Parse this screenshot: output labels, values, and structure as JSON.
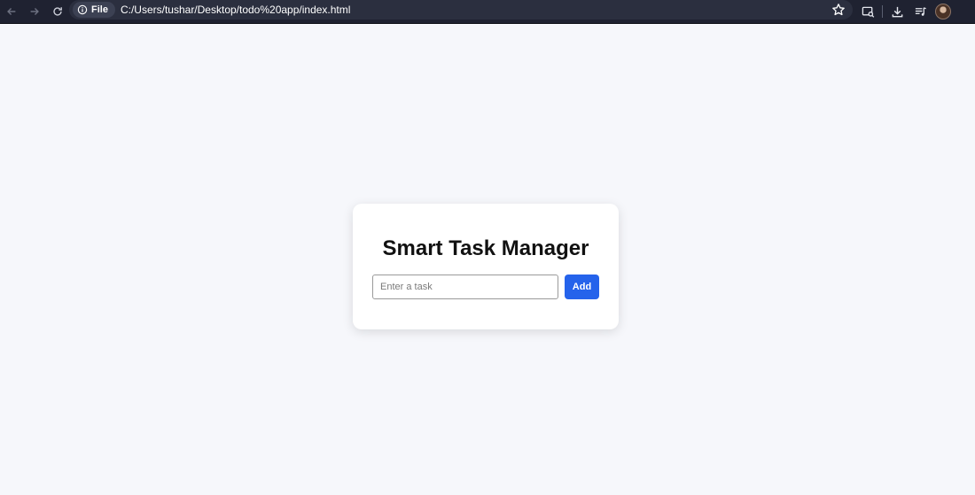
{
  "browser": {
    "scheme_chip": "File",
    "url": "C:/Users/tushar/Desktop/todo%20app/index.html",
    "icons": [
      "back-icon",
      "forward-icon",
      "reload-icon",
      "info-icon",
      "star-icon",
      "lens-icon",
      "download-icon",
      "media-icon",
      "avatar"
    ]
  },
  "app": {
    "title": "Smart Task Manager",
    "task_input": {
      "value": "",
      "placeholder": "Enter a task"
    },
    "add_label": "Add"
  },
  "colors": {
    "page_bg": "#f6f7fb",
    "card_bg": "#ffffff",
    "accent": "#2563eb",
    "browser_bar": "#1f2231"
  }
}
